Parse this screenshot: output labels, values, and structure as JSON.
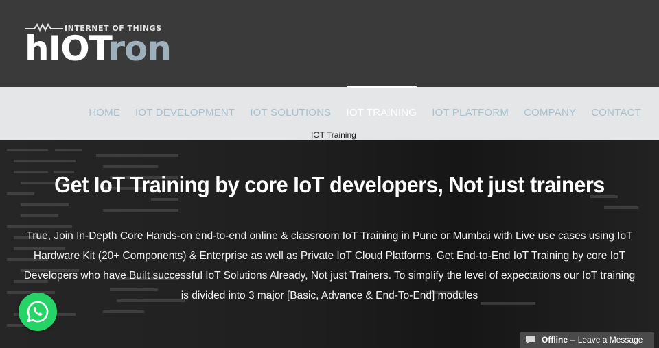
{
  "logo": {
    "tagline": "INTERNET OF THINGS",
    "word_a": "hIOT",
    "word_b": "ron"
  },
  "nav": {
    "items": [
      {
        "label": "HOME"
      },
      {
        "label": "IOT DEVELOPMENT"
      },
      {
        "label": "IOT SOLUTIONS"
      },
      {
        "label": "IOT TRAINING",
        "active": true
      },
      {
        "label": "IOT PLATFORM"
      },
      {
        "label": "COMPANY"
      },
      {
        "label": "CONTACT"
      }
    ],
    "submenu_label": "IOT Training"
  },
  "hero": {
    "title": "Get IoT Training by core IoT developers, Not just trainers",
    "body": "True, Join In-Depth Core Hands-on end-to-end online & classroom IoT Training in Pune or Mumbai with Live use cases using IoT Hardware Kit (20+ Components) & Enterprise as well as Private IoT Cloud Platforms. Get End-to-End IoT Training by core IoT Developers who have Built successful IoT Solutions Already, Not just Trainers. To simplify the level of expectations our IoT training is divided into 3 major [Basic, Advance & End-To-End] modules"
  },
  "widgets": {
    "whatsapp_icon": "whatsapp-icon",
    "chat_status": "Offline",
    "chat_separator": "–",
    "chat_action": "Leave a Message"
  },
  "colors": {
    "header_bg": "#3a3a3a",
    "nav_bg": "#e4e6e7",
    "nav_text": "#a9c0cf",
    "whatsapp": "#25d366"
  }
}
